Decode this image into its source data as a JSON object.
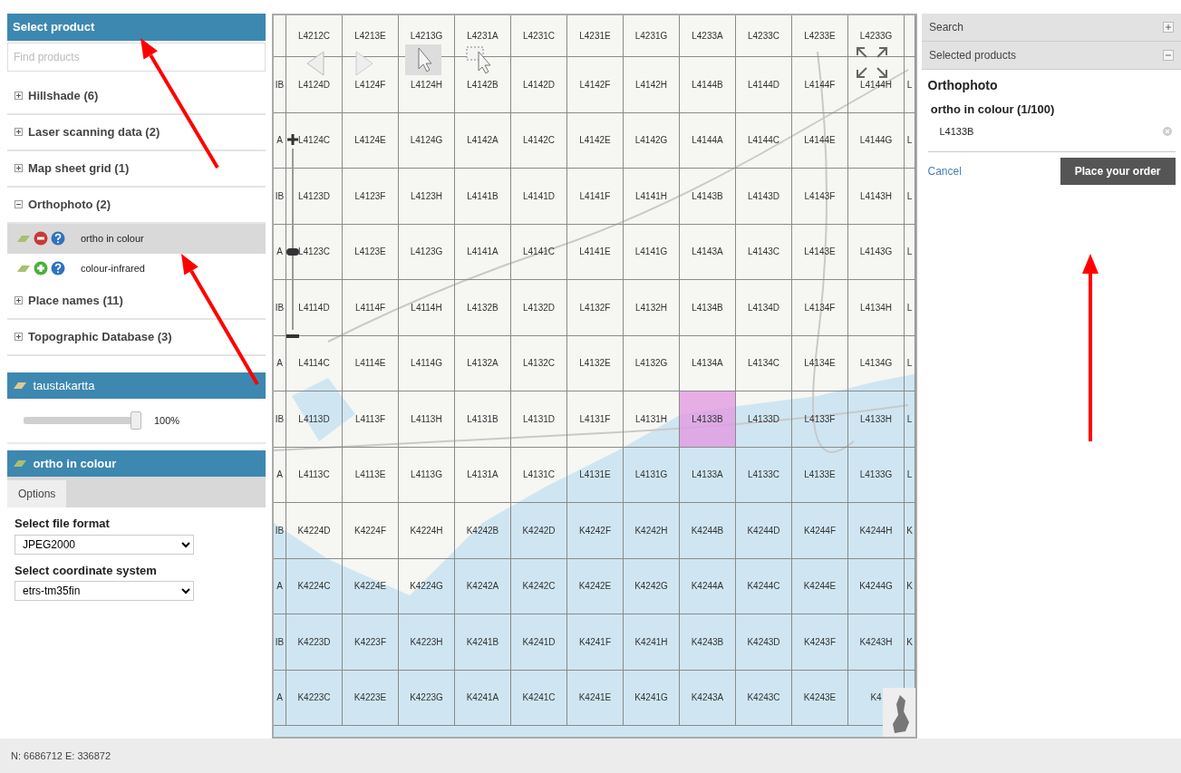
{
  "left_panel": {
    "header": "Select product",
    "search": {
      "placeholder": "Find products"
    },
    "categories": [
      {
        "label": "Hillshade (6)",
        "expanded": false
      },
      {
        "label": "Laser scanning data (2)",
        "expanded": false
      },
      {
        "label": "Map sheet grid (1)",
        "expanded": false
      },
      {
        "label": "Orthophoto (2)",
        "expanded": true,
        "children": [
          {
            "label": "ortho in colour",
            "selected": true,
            "in_order": true
          },
          {
            "label": "colour-infrared",
            "selected": false,
            "in_order": false
          }
        ]
      },
      {
        "label": "Place names (11)",
        "expanded": false
      },
      {
        "label": "Topographic Database (3)",
        "expanded": false
      }
    ]
  },
  "background_layer": {
    "title": "taustakartta",
    "opacity": {
      "level": 1.0,
      "reading": "100%"
    }
  },
  "product_options": {
    "title": "ortho in colour",
    "tabs": [
      {
        "label": "Options",
        "selected": true
      }
    ],
    "fields": [
      {
        "label": "Select file format",
        "value": "JPEG2000"
      },
      {
        "label": "Select coordinate system",
        "value": "etrs-tm35fin"
      }
    ]
  },
  "map": {
    "zoom": {
      "level": 0.43
    },
    "sheet_rows": [
      {
        "sheets": [
          {
            "label": "L4212C",
            "selected": false
          },
          {
            "label": "L4213E",
            "selected": false
          },
          {
            "label": "L4213G",
            "selected": false
          },
          {
            "label": "L4231A",
            "selected": false
          },
          {
            "label": "L4231C",
            "selected": false
          },
          {
            "label": "L4231E",
            "selected": false
          },
          {
            "label": "L4231G",
            "selected": false
          },
          {
            "label": "L4233A",
            "selected": false
          },
          {
            "label": "L4233C",
            "selected": false
          },
          {
            "label": "L4233E",
            "selected": false
          },
          {
            "label": "L4233G",
            "selected": false
          }
        ]
      },
      {
        "cut_left": "IB",
        "sheets": [
          {
            "label": "L4124D",
            "selected": false
          },
          {
            "label": "L4124F",
            "selected": false
          },
          {
            "label": "L4124H",
            "selected": false
          },
          {
            "label": "L4142B",
            "selected": false
          },
          {
            "label": "L4142D",
            "selected": false
          },
          {
            "label": "L4142F",
            "selected": false
          },
          {
            "label": "L4142H",
            "selected": false
          },
          {
            "label": "L4144B",
            "selected": false
          },
          {
            "label": "L4144D",
            "selected": false
          },
          {
            "label": "L4144F",
            "selected": false
          },
          {
            "label": "L4144H",
            "selected": false
          }
        ],
        "cut_right": "L"
      },
      {
        "cut_left": "A",
        "sheets": [
          {
            "label": "L4124C",
            "selected": false
          },
          {
            "label": "L4124E",
            "selected": false
          },
          {
            "label": "L4124G",
            "selected": false
          },
          {
            "label": "L4142A",
            "selected": false
          },
          {
            "label": "L4142C",
            "selected": false
          },
          {
            "label": "L4142E",
            "selected": false
          },
          {
            "label": "L4142G",
            "selected": false
          },
          {
            "label": "L4144A",
            "selected": false
          },
          {
            "label": "L4144C",
            "selected": false
          },
          {
            "label": "L4144E",
            "selected": false
          },
          {
            "label": "L4144G",
            "selected": false
          }
        ],
        "cut_right": "L"
      },
      {
        "cut_left": "IB",
        "sheets": [
          {
            "label": "L4123D",
            "selected": false
          },
          {
            "label": "L4123F",
            "selected": false
          },
          {
            "label": "L4123H",
            "selected": false
          },
          {
            "label": "L4141B",
            "selected": false
          },
          {
            "label": "L4141D",
            "selected": false
          },
          {
            "label": "L4141F",
            "selected": false
          },
          {
            "label": "L4141H",
            "selected": false
          },
          {
            "label": "L4143B",
            "selected": false
          },
          {
            "label": "L4143D",
            "selected": false
          },
          {
            "label": "L4143F",
            "selected": false
          },
          {
            "label": "L4143H",
            "selected": false
          }
        ],
        "cut_right": "L"
      },
      {
        "cut_left": "A",
        "sheets": [
          {
            "label": "L4123C",
            "selected": false
          },
          {
            "label": "L4123E",
            "selected": false
          },
          {
            "label": "L4123G",
            "selected": false
          },
          {
            "label": "L4141A",
            "selected": false
          },
          {
            "label": "L4141C",
            "selected": false
          },
          {
            "label": "L4141E",
            "selected": false
          },
          {
            "label": "L4141G",
            "selected": false
          },
          {
            "label": "L4143A",
            "selected": false
          },
          {
            "label": "L4143C",
            "selected": false
          },
          {
            "label": "L4143E",
            "selected": false
          },
          {
            "label": "L4143G",
            "selected": false
          }
        ],
        "cut_right": "L"
      },
      {
        "cut_left": "IB",
        "sheets": [
          {
            "label": "L4114D",
            "selected": false
          },
          {
            "label": "L4114F",
            "selected": false
          },
          {
            "label": "L4114H",
            "selected": false
          },
          {
            "label": "L4132B",
            "selected": false
          },
          {
            "label": "L4132D",
            "selected": false
          },
          {
            "label": "L4132F",
            "selected": false
          },
          {
            "label": "L4132H",
            "selected": false
          },
          {
            "label": "L4134B",
            "selected": false
          },
          {
            "label": "L4134D",
            "selected": false
          },
          {
            "label": "L4134F",
            "selected": false
          },
          {
            "label": "L4134H",
            "selected": false
          }
        ],
        "cut_right": "L"
      },
      {
        "cut_left": "A",
        "sheets": [
          {
            "label": "L4114C",
            "selected": false
          },
          {
            "label": "L4114E",
            "selected": false
          },
          {
            "label": "L4114G",
            "selected": false
          },
          {
            "label": "L4132A",
            "selected": false
          },
          {
            "label": "L4132C",
            "selected": false
          },
          {
            "label": "L4132E",
            "selected": false
          },
          {
            "label": "L4132G",
            "selected": false
          },
          {
            "label": "L4134A",
            "selected": false
          },
          {
            "label": "L4134C",
            "selected": false
          },
          {
            "label": "L4134E",
            "selected": false
          },
          {
            "label": "L4134G",
            "selected": false
          }
        ],
        "cut_right": "L"
      },
      {
        "cut_left": "IB",
        "sheets": [
          {
            "label": "L4113D",
            "selected": false
          },
          {
            "label": "L4113F",
            "selected": false
          },
          {
            "label": "L4113H",
            "selected": false
          },
          {
            "label": "L4131B",
            "selected": false
          },
          {
            "label": "L4131D",
            "selected": false
          },
          {
            "label": "L4131F",
            "selected": false
          },
          {
            "label": "L4131H",
            "selected": false
          },
          {
            "label": "L4133B",
            "selected": true
          },
          {
            "label": "L4133D",
            "selected": false
          },
          {
            "label": "L4133F",
            "selected": false
          },
          {
            "label": "L4133H",
            "selected": false
          }
        ],
        "cut_right": "L"
      },
      {
        "cut_left": "A",
        "sheets": [
          {
            "label": "L4113C",
            "selected": false
          },
          {
            "label": "L4113E",
            "selected": false
          },
          {
            "label": "L4113G",
            "selected": false
          },
          {
            "label": "L4131A",
            "selected": false
          },
          {
            "label": "L4131C",
            "selected": false
          },
          {
            "label": "L4131E",
            "selected": false
          },
          {
            "label": "L4131G",
            "selected": false
          },
          {
            "label": "L4133A",
            "selected": false
          },
          {
            "label": "L4133C",
            "selected": false
          },
          {
            "label": "L4133E",
            "selected": false
          },
          {
            "label": "L4133G",
            "selected": false
          }
        ],
        "cut_right": "L"
      },
      {
        "cut_left": "IB",
        "sheets": [
          {
            "label": "K4224D",
            "selected": false
          },
          {
            "label": "K4224F",
            "selected": false
          },
          {
            "label": "K4224H",
            "selected": false
          },
          {
            "label": "K4242B",
            "selected": false
          },
          {
            "label": "K4242D",
            "selected": false
          },
          {
            "label": "K4242F",
            "selected": false
          },
          {
            "label": "K4242H",
            "selected": false
          },
          {
            "label": "K4244B",
            "selected": false
          },
          {
            "label": "K4244D",
            "selected": false
          },
          {
            "label": "K4244F",
            "selected": false
          },
          {
            "label": "K4244H",
            "selected": false
          }
        ],
        "cut_right": "K"
      },
      {
        "cut_left": "A",
        "sheets": [
          {
            "label": "K4224C",
            "selected": false
          },
          {
            "label": "K4224E",
            "selected": false
          },
          {
            "label": "K4224G",
            "selected": false
          },
          {
            "label": "K4242A",
            "selected": false
          },
          {
            "label": "K4242C",
            "selected": false
          },
          {
            "label": "K4242E",
            "selected": false
          },
          {
            "label": "K4242G",
            "selected": false
          },
          {
            "label": "K4244A",
            "selected": false
          },
          {
            "label": "K4244C",
            "selected": false
          },
          {
            "label": "K4244E",
            "selected": false
          },
          {
            "label": "K4244G",
            "selected": false
          }
        ],
        "cut_right": "K"
      },
      {
        "cut_left": "IB",
        "sheets": [
          {
            "label": "K4223D",
            "selected": false
          },
          {
            "label": "K4223F",
            "selected": false
          },
          {
            "label": "K4223H",
            "selected": false
          },
          {
            "label": "K4241B",
            "selected": false
          },
          {
            "label": "K4241D",
            "selected": false
          },
          {
            "label": "K4241F",
            "selected": false
          },
          {
            "label": "K4241H",
            "selected": false
          },
          {
            "label": "K4243B",
            "selected": false
          },
          {
            "label": "K4243D",
            "selected": false
          },
          {
            "label": "K4243F",
            "selected": false
          },
          {
            "label": "K4243H",
            "selected": false
          }
        ],
        "cut_right": "K"
      },
      {
        "cut_left": "A",
        "sheets": [
          {
            "label": "K4223C",
            "selected": false
          },
          {
            "label": "K4223E",
            "selected": false
          },
          {
            "label": "K4223G",
            "selected": false
          },
          {
            "label": "K4241A",
            "selected": false
          },
          {
            "label": "K4241C",
            "selected": false
          },
          {
            "label": "K4241E",
            "selected": false
          },
          {
            "label": "K4241G",
            "selected": false
          },
          {
            "label": "K4243A",
            "selected": false
          },
          {
            "label": "K4243C",
            "selected": false
          },
          {
            "label": "K4243E",
            "selected": false
          },
          {
            "label": "K4",
            "selected": false
          }
        ]
      }
    ]
  },
  "right_panel": {
    "sections": [
      {
        "label": "Search",
        "expanded": false
      },
      {
        "label": "Selected products",
        "expanded": true
      }
    ],
    "product_group": "Orthophoto",
    "product": "ortho in colour (1/100)",
    "sheets": [
      "L4133B"
    ],
    "cancel": "Cancel",
    "order_button": "Place your order"
  },
  "status_bar": "N: 6686712 E: 336872"
}
